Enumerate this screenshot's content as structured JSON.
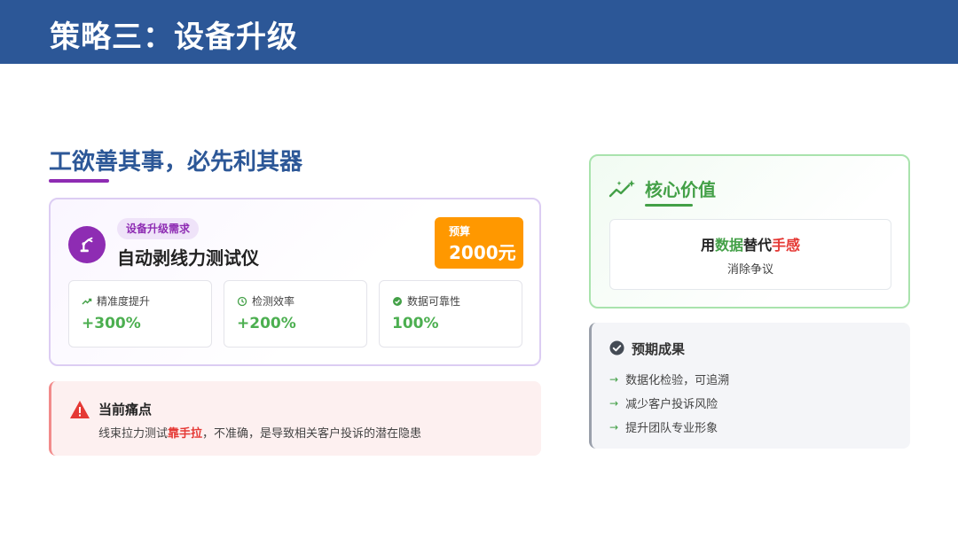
{
  "header": {
    "title": "策略三：设备升级"
  },
  "section": {
    "title": "工欲善其事，必先利其器"
  },
  "device": {
    "tag": "设备升级需求",
    "name": "自动剥线力测试仪",
    "budget_label": "预算",
    "budget_value": "2000元",
    "icon": "robot-arm-icon",
    "accent_color": "#8e2cb3",
    "budget_color": "#ff9800",
    "metrics": [
      {
        "icon": "trend-up-icon",
        "label": "精准度提升",
        "value": "+300%"
      },
      {
        "icon": "clock-icon",
        "label": "检测效率",
        "value": "+200%"
      },
      {
        "icon": "check-circle-icon",
        "label": "数据可靠性",
        "value": "100%"
      }
    ]
  },
  "pain": {
    "icon": "warning-icon",
    "title": "当前痛点",
    "desc_prefix": "线束拉力测试",
    "desc_highlight": "靠手拉",
    "desc_suffix": "，不准确，是导致相关客户投诉的潜在隐患"
  },
  "core": {
    "icon": "sparkle-chart-icon",
    "title": "核心价值",
    "main_part1": "用",
    "main_part2": "数据",
    "main_part3": "替代",
    "main_part4": "手感",
    "sub": "消除争议",
    "accent_color": "#43a047"
  },
  "results": {
    "icon": "check-circle-icon",
    "title": "预期成果",
    "items": [
      "数据化检验，可追溯",
      "减少客户投诉风险",
      "提升团队专业形象"
    ]
  }
}
